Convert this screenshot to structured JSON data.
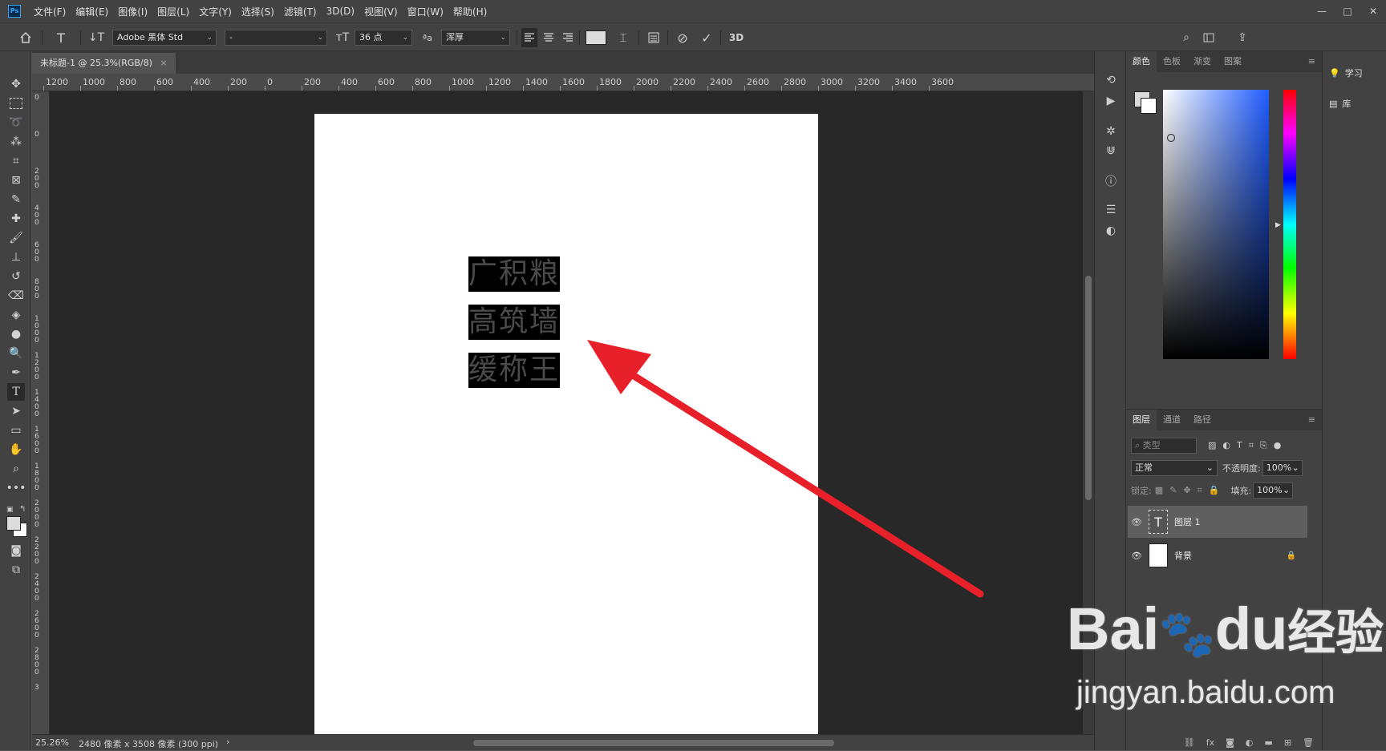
{
  "menu": {
    "logo": "Ps",
    "items": [
      "文件(F)",
      "编辑(E)",
      "图像(I)",
      "图层(L)",
      "文字(Y)",
      "选择(S)",
      "滤镜(T)",
      "3D(D)",
      "视图(V)",
      "窗口(W)",
      "帮助(H)"
    ],
    "window_controls": [
      "—",
      "□",
      "✕"
    ]
  },
  "options_bar": {
    "font_family": "Adobe 黑体 Std",
    "font_style": "-",
    "font_size": "36 点",
    "aa_label": "ªa",
    "anti_alias": "浑厚",
    "three_d": "3D"
  },
  "document": {
    "tab_title": "未标题-1 @ 25.3%(RGB/8)",
    "tab_close": "×",
    "lines": [
      "广积粮",
      "高筑墙",
      "缓称王"
    ]
  },
  "ruler": {
    "top_labels": [
      "1200",
      "1000",
      "800",
      "600",
      "400",
      "200",
      "0",
      "200",
      "400",
      "600",
      "800",
      "1000",
      "1200",
      "1400",
      "1600",
      "1800",
      "2000",
      "2200",
      "2400",
      "2600",
      "2800",
      "3000",
      "3200",
      "3400",
      "3600"
    ],
    "left_labels": [
      "0",
      "0",
      "2 0 0",
      "4 0 0",
      "6 0 0",
      "8 0 0",
      "1 0 0 0",
      "1 2 0 0",
      "1 4 0 0",
      "1 6 0 0",
      "1 8 0 0",
      "2 0 0 0",
      "2 2 0 0",
      "2 4 0 0",
      "2 6 0 0",
      "2 8 0 0",
      "3"
    ]
  },
  "status": {
    "zoom": "25.26%",
    "doc_info": "2480 像素 x 3508 像素 (300 ppi)",
    "chevron": "›"
  },
  "color_panel": {
    "tabs": [
      "颜色",
      "色板",
      "渐变",
      "图案"
    ],
    "foreground": "#dcdcdc",
    "background": "#ffffff"
  },
  "learn_panel": {
    "items": [
      "学习",
      "库"
    ]
  },
  "layers_panel": {
    "tabs": [
      "图层",
      "通道",
      "路径"
    ],
    "filter_placeholder": "类型",
    "blend_mode": "正常",
    "opacity_label": "不透明度:",
    "opacity_value": "100%",
    "lock_label": "锁定:",
    "fill_label": "填充:",
    "fill_value": "100%",
    "layers": [
      {
        "name": "图层 1",
        "type_icon": "T"
      },
      {
        "name": "背景"
      }
    ]
  },
  "watermark": {
    "brand": "Bai",
    "brand2": "du",
    "suffix": "经验",
    "url": "jingyan.baidu.com"
  },
  "colors": {
    "annotation_arrow": "#e8202a",
    "app_bg": "#535353",
    "canvas_bg": "#282828"
  }
}
